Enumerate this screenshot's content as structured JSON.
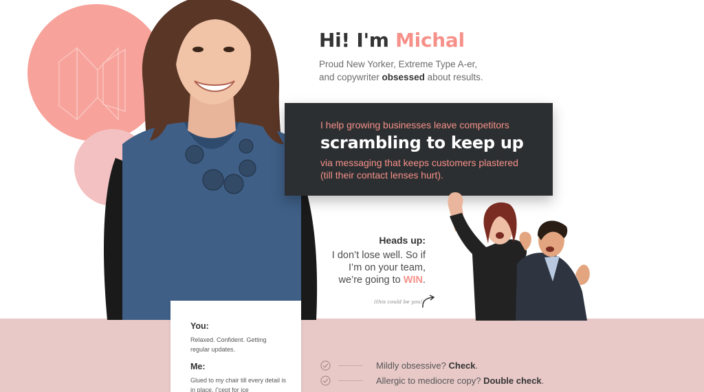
{
  "hero": {
    "greeting": "Hi! I'm ",
    "name": "Michal",
    "sub_line1": "Proud New Yorker, Extreme Type A-er,",
    "sub_line2_pre": "and copywriter ",
    "sub_line2_bold": "obsessed",
    "sub_line2_post": " about results."
  },
  "callout": {
    "line1": "I help growing businesses leave competitors",
    "headline": "scrambling to keep up",
    "line3": "via messaging that keeps customers plastered (till their contact lenses hurt)."
  },
  "heads_up": {
    "title": "Heads up:",
    "line1": "I don’t lose well. So if",
    "line2": "I’m on your team,",
    "line3_pre": "we’re going to ",
    "line3_win": "WIN",
    "line3_post": ".",
    "note": "(this could be you!)"
  },
  "card": {
    "you_label": "You:",
    "you_text": "Relaxed. Confident. Getting regular updates.",
    "me_label": "Me:",
    "me_text": "Glued to my chair till every detail is in place. ('cept for ice"
  },
  "checklist": [
    {
      "text": "Mildly obsessive? ",
      "bold": "Check",
      "end": "."
    },
    {
      "text": "Allergic to mediocre copy? ",
      "bold": "Double check",
      "end": "."
    }
  ],
  "colors": {
    "accent": "#f6918a",
    "callout_bg": "#2c2f31",
    "band": "#e8c9c8"
  }
}
